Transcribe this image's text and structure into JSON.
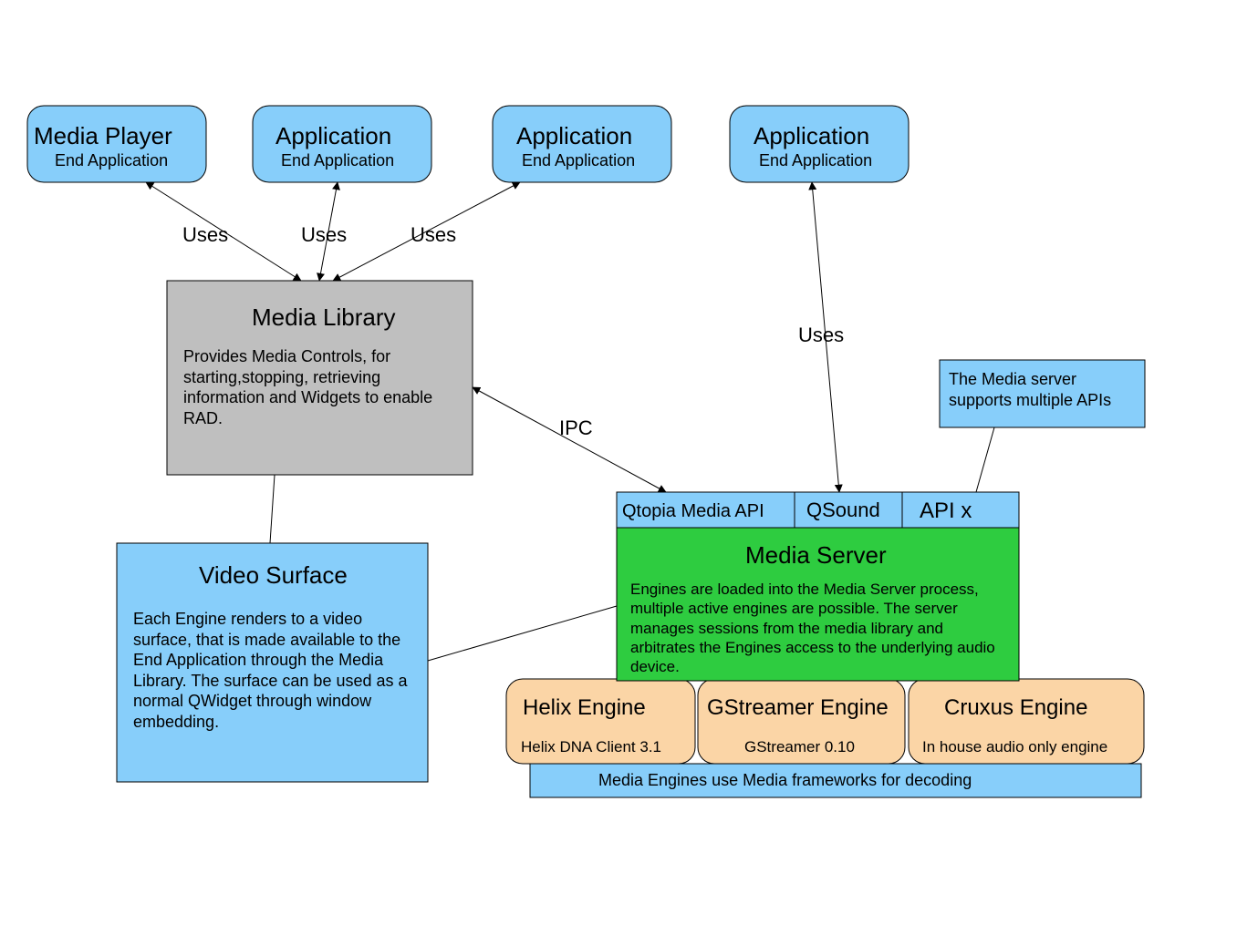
{
  "apps": [
    {
      "title": "Media Player",
      "sub": "End Application"
    },
    {
      "title": "Application",
      "sub": "End Application"
    },
    {
      "title": "Application",
      "sub": "End Application"
    },
    {
      "title": "Application",
      "sub": "End Application"
    }
  ],
  "media_library": {
    "title": "Media Library",
    "body": "Provides Media Controls, for starting,stopping, retrieving information and Widgets to enable RAD."
  },
  "video_surface": {
    "title": "Video Surface",
    "body": "Each Engine renders to a video surface, that is made available to the End Application through the Media Library. The surface can be used as a normal QWidget through window embedding."
  },
  "apis": [
    "Qtopia Media API",
    "QSound",
    "API x"
  ],
  "api_note": "The Media server supports multiple APIs",
  "media_server": {
    "title": "Media Server",
    "body": "Engines are loaded into the Media Server process, multiple active engines are possible. The server manages sessions from the media library and arbitrates the Engines access to the underlying audio device."
  },
  "engines": [
    {
      "title": "Helix Engine",
      "sub": "Helix DNA Client 3.1"
    },
    {
      "title": "GStreamer Engine",
      "sub": "GStreamer 0.10"
    },
    {
      "title": "Cruxus Engine",
      "sub": "In house audio only engine"
    }
  ],
  "frameworks_note": "Media Engines use Media frameworks for decoding",
  "edges": {
    "uses": "Uses",
    "ipc": "IPC"
  }
}
